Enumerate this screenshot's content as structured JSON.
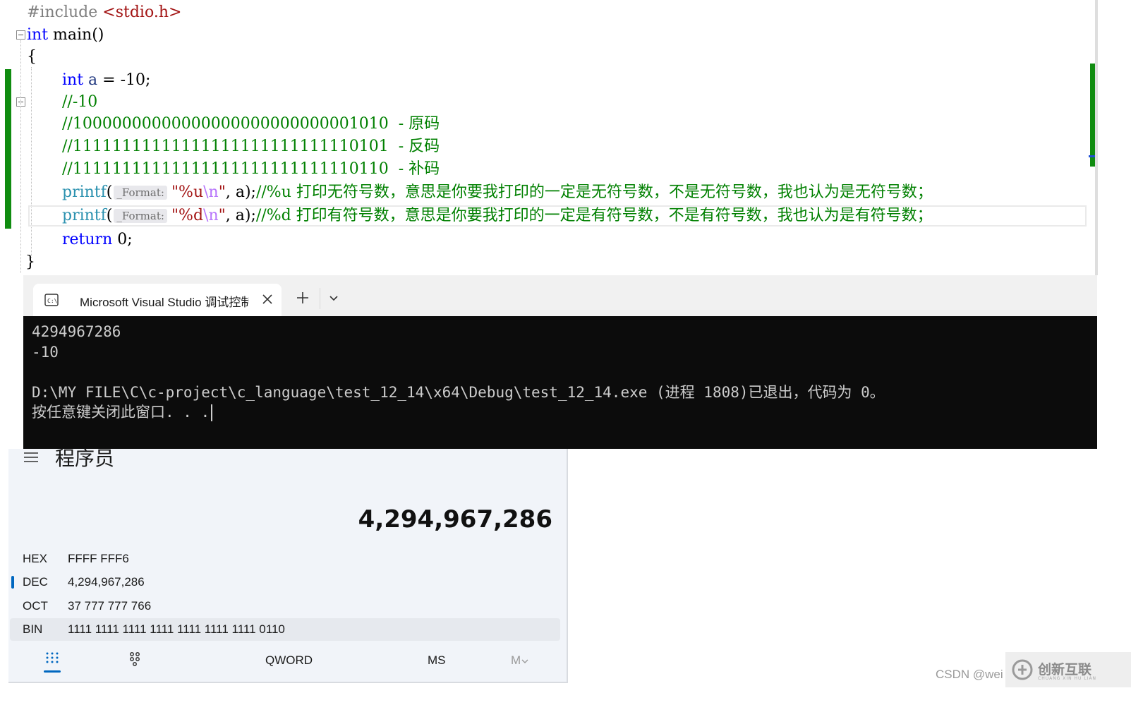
{
  "editor": {
    "include_directive": "#include",
    "include_header": "<stdio.h>",
    "main_type": "int",
    "main_sig": " main()",
    "open_brace": "{",
    "close_brace": "}",
    "decl_type": "int",
    "decl_var": "a",
    "decl_rest": " = -10;",
    "comment_value": "//-10",
    "comment_original": "//10000000000000000000000000001010  - 原码",
    "comment_ones": "//11111111111111111111111111110101  - 反码",
    "comment_twos": "//11111111111111111111111111110110  - 补码",
    "printf_fn": "printf",
    "paren_open": "(",
    "hint_label": "_Format:",
    "printf_u_str": "\"%u",
    "printf_d_str": "\"%d",
    "escape_n": "\\n",
    "quote_close": "\"",
    "args_end": ", a);",
    "comment_u": "//%u 打印无符号数，意思是你要我打印的一定是无符号数，不是无符号数，我也认为是无符号数；",
    "comment_d": "//%d 打印有符号数，意思是你要我打印的一定是有符号数，不是有符号数，我也认为是有符号数；",
    "return_kw": "return",
    "return_rest": " 0;"
  },
  "terminal": {
    "tab_title": "Microsoft Visual Studio 调试控制台",
    "output_lines": [
      "4294967286",
      "-10",
      "",
      "D:\\MY FILE\\C\\c-project\\c_language\\test_12_14\\x64\\Debug\\test_12_14.exe (进程 1808)已退出，代码为 0。",
      "按任意键关闭此窗口. . ."
    ]
  },
  "calculator": {
    "mode_title": "程序员",
    "display_value": "4,294,967,286",
    "radix": [
      {
        "label": "HEX",
        "value": "FFFF FFF6"
      },
      {
        "label": "DEC",
        "value": "4,294,967,286"
      },
      {
        "label": "OCT",
        "value": "37 777 777 766"
      },
      {
        "label": "BIN",
        "value": "1111 1111 1111 1111 1111 1111 1111 0110"
      }
    ],
    "selected_radix": "DEC",
    "word_size": "QWORD",
    "memory_store": "MS",
    "memory_menu": "M",
    "accent_color": "#0067c0"
  },
  "watermark": {
    "csdn": "CSDN @wei",
    "logo_text": "创新互联",
    "logo_sub": "CHUANG XIN HU LIAN"
  }
}
